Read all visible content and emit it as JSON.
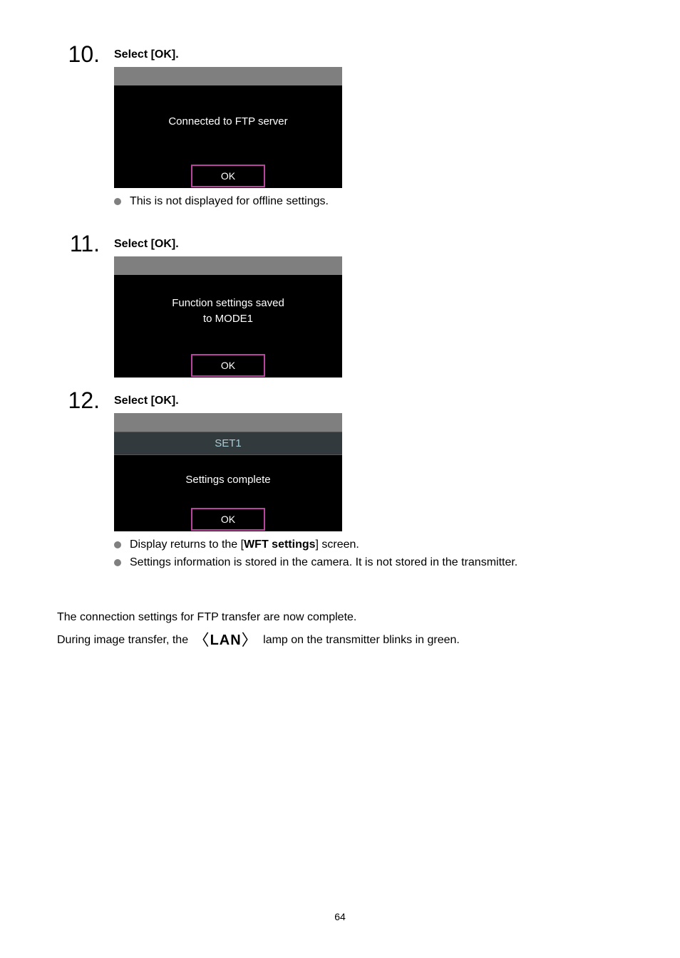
{
  "steps": [
    {
      "number": "10.",
      "title": "Select [OK].",
      "screen": {
        "type": "simple",
        "lines": [
          "Connected to FTP server"
        ],
        "ok": "OK"
      },
      "bullets": [
        {
          "text": "This is not displayed for offline settings."
        }
      ]
    },
    {
      "number": "11.",
      "title": "Select [OK].",
      "screen": {
        "type": "simple",
        "lines": [
          "Function settings saved",
          "to MODE1"
        ],
        "ok": "OK"
      },
      "bullets": []
    },
    {
      "number": "12.",
      "title": "Select [OK].",
      "screen": {
        "type": "set",
        "header": "SET1",
        "body": "Settings complete",
        "ok": "OK"
      },
      "bullets": [
        {
          "prefix": "Display returns to the [",
          "bold": "WFT settings",
          "suffix": "] screen."
        },
        {
          "text": "Settings information is stored in the camera. It is not stored in the transmitter."
        }
      ]
    }
  ],
  "closing": {
    "line1": "The connection settings for FTP transfer are now complete.",
    "line2_prefix": "During image transfer, the ",
    "line2_lan": "LAN",
    "line2_suffix": " lamp on the transmitter blinks in green."
  },
  "pageNumber": "64"
}
